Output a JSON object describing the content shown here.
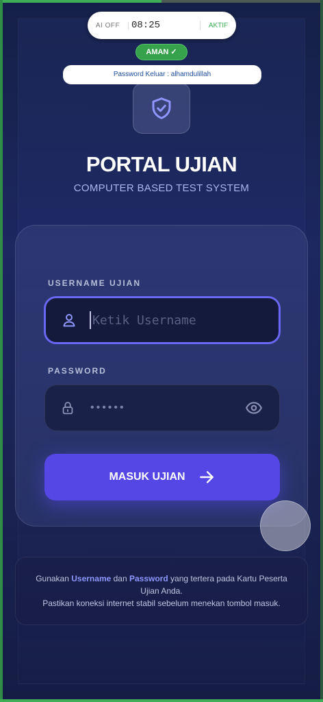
{
  "status_bar": {
    "ai_label": "AI OFF",
    "time": "08:25",
    "status_label": "AKTIF",
    "safe_badge": "AMAN ✓"
  },
  "exit_password_notice": "Password Keluar : alhamdulillah",
  "brand": {
    "logo_icon": "shield-check-icon",
    "title": "PORTAL UJIAN",
    "subtitle": "COMPUTER BASED TEST SYSTEM"
  },
  "login_form": {
    "username_label": "USERNAME UJIAN",
    "username_placeholder": "Ketik Username",
    "username_value": "",
    "username_icon": "user-icon",
    "password_label": "PASSWORD",
    "password_masked": "••••••",
    "password_icon": "lock-icon",
    "visibility_icon": "eye-icon",
    "submit_label": "MASUK UJIAN",
    "submit_icon": "arrow-right-icon"
  },
  "info": {
    "line1_prefix": "Gunakan ",
    "line1_username": "Username",
    "line1_mid": " dan ",
    "line1_password": "Password",
    "line1_suffix": " yang tertera pada Kartu Peserta",
    "line2": "Ujian Anda.",
    "line3": "Pastikan koneksi internet stabil sebelum menekan tombol masuk."
  },
  "colors": {
    "accent": "#5547e6",
    "focus_border": "#6b67f5",
    "success": "#36a24b",
    "background": "#1d2760"
  }
}
